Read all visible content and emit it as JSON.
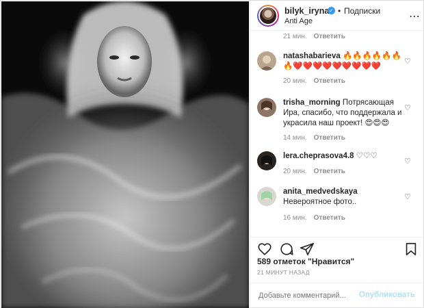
{
  "header": {
    "username": "bilyk_iryna",
    "verified_mark": "✓",
    "separator": "•",
    "follow_label": "Подписки",
    "location": "Anti Age",
    "more_icon": "more-horizontal-icon"
  },
  "comments": {
    "top_meta": {
      "time": "21 мин.",
      "reply": "Ответить"
    },
    "items": [
      {
        "username": "natashabarieva",
        "text": "🔥🔥🔥🔥🔥🔥🔥❤️❤️❤️❤️❤️❤️❤️❤️❤️",
        "time": "20 мин.",
        "reply": "Ответить"
      },
      {
        "username": "trisha_morning",
        "text": "Потрясающая Ира, спасибо, что поддержала и украсила наш проект! 😍😍😍",
        "time": "14 мин.",
        "reply": "Ответить"
      },
      {
        "username": "lera.cheprasova4.8",
        "text": "♡♡♡",
        "time": "20 мин.",
        "reply": "Ответить"
      },
      {
        "username": "anita_medvedskaya",
        "text": "Невероятное фото..",
        "time": "16 мин.",
        "reply": "Ответить"
      }
    ]
  },
  "actions": {
    "likes": "589 отметок \"Нравится\"",
    "timestamp": "21 МИНУТ НАЗАД"
  },
  "add_comment": {
    "placeholder": "Добавьте комментарий...",
    "publish_label": "Опубликовать"
  },
  "colors": {
    "verified": "#3897f0",
    "publish_disabled": "#b2dffc",
    "meta_gray": "#8e8e8e"
  }
}
